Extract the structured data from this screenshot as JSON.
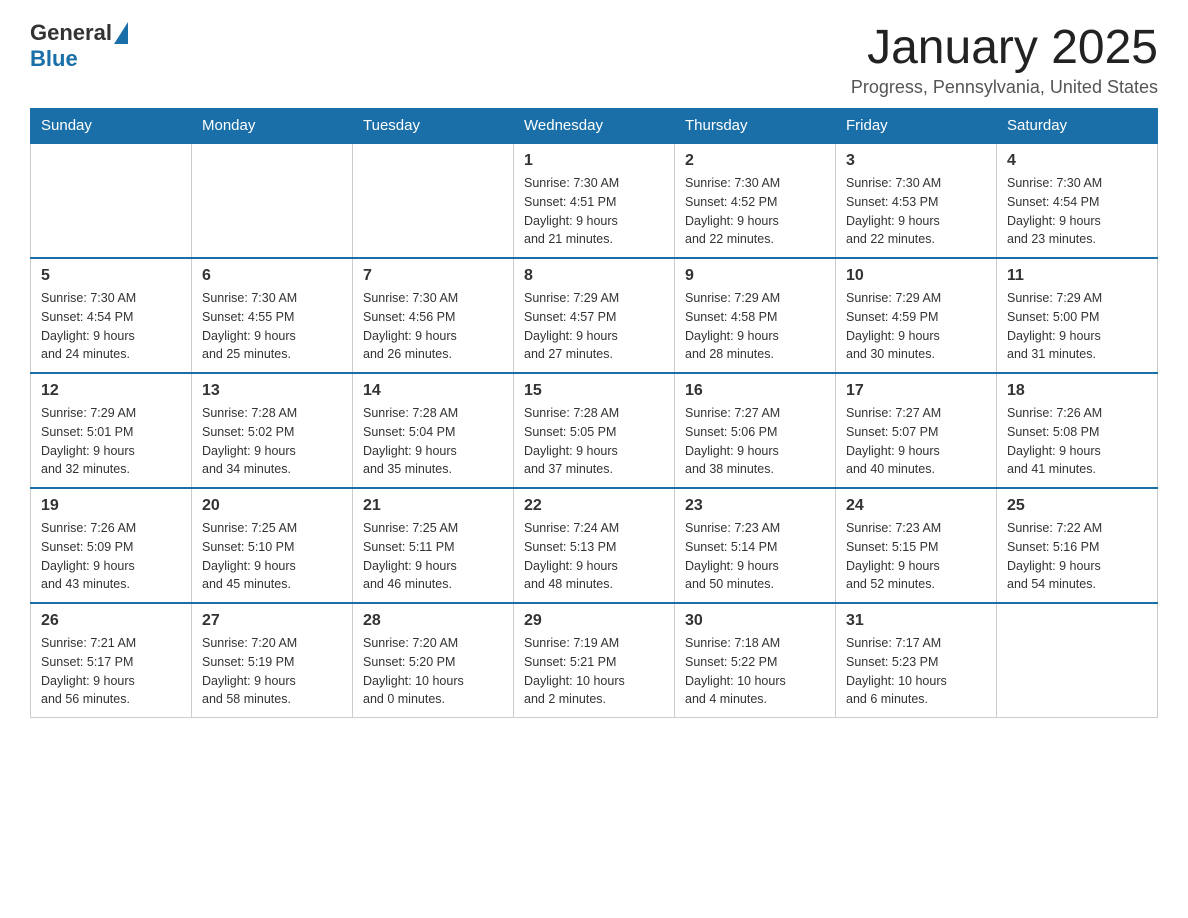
{
  "logo": {
    "general": "General",
    "blue": "Blue"
  },
  "title": "January 2025",
  "subtitle": "Progress, Pennsylvania, United States",
  "days_of_week": [
    "Sunday",
    "Monday",
    "Tuesday",
    "Wednesday",
    "Thursday",
    "Friday",
    "Saturday"
  ],
  "weeks": [
    [
      {
        "day": "",
        "info": ""
      },
      {
        "day": "",
        "info": ""
      },
      {
        "day": "",
        "info": ""
      },
      {
        "day": "1",
        "info": "Sunrise: 7:30 AM\nSunset: 4:51 PM\nDaylight: 9 hours\nand 21 minutes."
      },
      {
        "day": "2",
        "info": "Sunrise: 7:30 AM\nSunset: 4:52 PM\nDaylight: 9 hours\nand 22 minutes."
      },
      {
        "day": "3",
        "info": "Sunrise: 7:30 AM\nSunset: 4:53 PM\nDaylight: 9 hours\nand 22 minutes."
      },
      {
        "day": "4",
        "info": "Sunrise: 7:30 AM\nSunset: 4:54 PM\nDaylight: 9 hours\nand 23 minutes."
      }
    ],
    [
      {
        "day": "5",
        "info": "Sunrise: 7:30 AM\nSunset: 4:54 PM\nDaylight: 9 hours\nand 24 minutes."
      },
      {
        "day": "6",
        "info": "Sunrise: 7:30 AM\nSunset: 4:55 PM\nDaylight: 9 hours\nand 25 minutes."
      },
      {
        "day": "7",
        "info": "Sunrise: 7:30 AM\nSunset: 4:56 PM\nDaylight: 9 hours\nand 26 minutes."
      },
      {
        "day": "8",
        "info": "Sunrise: 7:29 AM\nSunset: 4:57 PM\nDaylight: 9 hours\nand 27 minutes."
      },
      {
        "day": "9",
        "info": "Sunrise: 7:29 AM\nSunset: 4:58 PM\nDaylight: 9 hours\nand 28 minutes."
      },
      {
        "day": "10",
        "info": "Sunrise: 7:29 AM\nSunset: 4:59 PM\nDaylight: 9 hours\nand 30 minutes."
      },
      {
        "day": "11",
        "info": "Sunrise: 7:29 AM\nSunset: 5:00 PM\nDaylight: 9 hours\nand 31 minutes."
      }
    ],
    [
      {
        "day": "12",
        "info": "Sunrise: 7:29 AM\nSunset: 5:01 PM\nDaylight: 9 hours\nand 32 minutes."
      },
      {
        "day": "13",
        "info": "Sunrise: 7:28 AM\nSunset: 5:02 PM\nDaylight: 9 hours\nand 34 minutes."
      },
      {
        "day": "14",
        "info": "Sunrise: 7:28 AM\nSunset: 5:04 PM\nDaylight: 9 hours\nand 35 minutes."
      },
      {
        "day": "15",
        "info": "Sunrise: 7:28 AM\nSunset: 5:05 PM\nDaylight: 9 hours\nand 37 minutes."
      },
      {
        "day": "16",
        "info": "Sunrise: 7:27 AM\nSunset: 5:06 PM\nDaylight: 9 hours\nand 38 minutes."
      },
      {
        "day": "17",
        "info": "Sunrise: 7:27 AM\nSunset: 5:07 PM\nDaylight: 9 hours\nand 40 minutes."
      },
      {
        "day": "18",
        "info": "Sunrise: 7:26 AM\nSunset: 5:08 PM\nDaylight: 9 hours\nand 41 minutes."
      }
    ],
    [
      {
        "day": "19",
        "info": "Sunrise: 7:26 AM\nSunset: 5:09 PM\nDaylight: 9 hours\nand 43 minutes."
      },
      {
        "day": "20",
        "info": "Sunrise: 7:25 AM\nSunset: 5:10 PM\nDaylight: 9 hours\nand 45 minutes."
      },
      {
        "day": "21",
        "info": "Sunrise: 7:25 AM\nSunset: 5:11 PM\nDaylight: 9 hours\nand 46 minutes."
      },
      {
        "day": "22",
        "info": "Sunrise: 7:24 AM\nSunset: 5:13 PM\nDaylight: 9 hours\nand 48 minutes."
      },
      {
        "day": "23",
        "info": "Sunrise: 7:23 AM\nSunset: 5:14 PM\nDaylight: 9 hours\nand 50 minutes."
      },
      {
        "day": "24",
        "info": "Sunrise: 7:23 AM\nSunset: 5:15 PM\nDaylight: 9 hours\nand 52 minutes."
      },
      {
        "day": "25",
        "info": "Sunrise: 7:22 AM\nSunset: 5:16 PM\nDaylight: 9 hours\nand 54 minutes."
      }
    ],
    [
      {
        "day": "26",
        "info": "Sunrise: 7:21 AM\nSunset: 5:17 PM\nDaylight: 9 hours\nand 56 minutes."
      },
      {
        "day": "27",
        "info": "Sunrise: 7:20 AM\nSunset: 5:19 PM\nDaylight: 9 hours\nand 58 minutes."
      },
      {
        "day": "28",
        "info": "Sunrise: 7:20 AM\nSunset: 5:20 PM\nDaylight: 10 hours\nand 0 minutes."
      },
      {
        "day": "29",
        "info": "Sunrise: 7:19 AM\nSunset: 5:21 PM\nDaylight: 10 hours\nand 2 minutes."
      },
      {
        "day": "30",
        "info": "Sunrise: 7:18 AM\nSunset: 5:22 PM\nDaylight: 10 hours\nand 4 minutes."
      },
      {
        "day": "31",
        "info": "Sunrise: 7:17 AM\nSunset: 5:23 PM\nDaylight: 10 hours\nand 6 minutes."
      },
      {
        "day": "",
        "info": ""
      }
    ]
  ]
}
